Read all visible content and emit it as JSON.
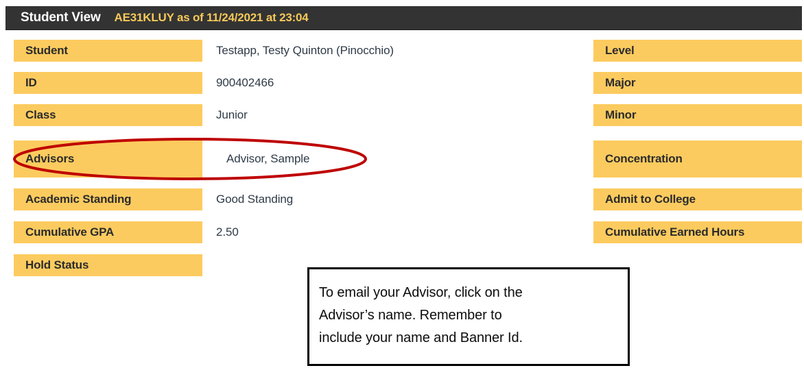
{
  "header": {
    "title": "Student View",
    "meta": "AE31KLUY as of 11/24/2021 at 23:04",
    "bar_color": "#333333",
    "title_color": "#ffffff",
    "meta_color": "#f6c95a"
  },
  "theme": {
    "label_background": "#fccb5f",
    "label_text": "#2b2b2b",
    "value_text": "#2e3a47",
    "annotation_red": "#be0000",
    "callout_border": "#000000"
  },
  "left_column": [
    {
      "label": "Student",
      "value": "Testapp, Testy Quinton (Pinocchio)"
    },
    {
      "label": "ID",
      "value": "900402466"
    },
    {
      "label": "Class",
      "value": "Junior"
    },
    {
      "label": "Advisors",
      "value": "Advisor, Sample"
    },
    {
      "label": "Academic Standing",
      "value": "Good Standing"
    },
    {
      "label": "Cumulative GPA",
      "value": "2.50"
    },
    {
      "label": "Hold Status",
      "value": ""
    }
  ],
  "right_column": [
    {
      "label": "Level",
      "value": ""
    },
    {
      "label": "Major",
      "value": ""
    },
    {
      "label": "Minor",
      "value": ""
    },
    {
      "label": "Concentration",
      "value": ""
    },
    {
      "label": "Admit to College",
      "value": ""
    },
    {
      "label": "Cumulative Earned Hours",
      "value": ""
    }
  ],
  "annotation": {
    "ellipse_name": "advisor-highlight-ellipse",
    "callout_text": "To email your Advisor, click on the\nAdvisor’s name.  Remember to\ninclude your name and Banner Id."
  }
}
